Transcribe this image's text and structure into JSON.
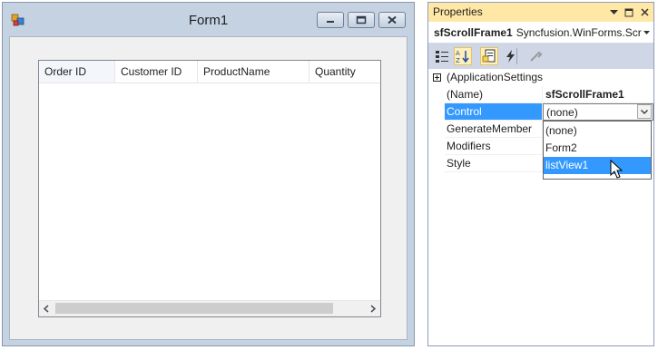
{
  "form": {
    "title": "Form1",
    "listview": {
      "columns": [
        "Order ID",
        "Customer ID",
        "ProductName",
        "Quantity"
      ]
    },
    "caption_buttons": [
      "minimize-icon",
      "maximize-icon",
      "close-icon"
    ]
  },
  "properties": {
    "title": "Properties",
    "object_name": "sfScrollFrame1",
    "object_type": "Syncfusion.WinForms.Scro",
    "toolbar": [
      "categorized-icon",
      "alphabetical-icon",
      "properties-icon",
      "events-icon",
      "property-pages-icon"
    ],
    "rows": [
      {
        "name": "(ApplicationSettings",
        "value": ""
      },
      {
        "name": "(Name)",
        "value": "sfScrollFrame1"
      },
      {
        "name": "Control",
        "value": "(none)"
      },
      {
        "name": "GenerateMember",
        "value": ""
      },
      {
        "name": "Modifiers",
        "value": ""
      },
      {
        "name": "Style",
        "value": ""
      }
    ],
    "dropdown_options": [
      "(none)",
      "Form2",
      "listView1"
    ],
    "highlighted_option": "listView1"
  },
  "colors": {
    "selection": "#3399ff",
    "panel_title": "#ffe8a6",
    "window_frame": "#c5d2e2"
  }
}
